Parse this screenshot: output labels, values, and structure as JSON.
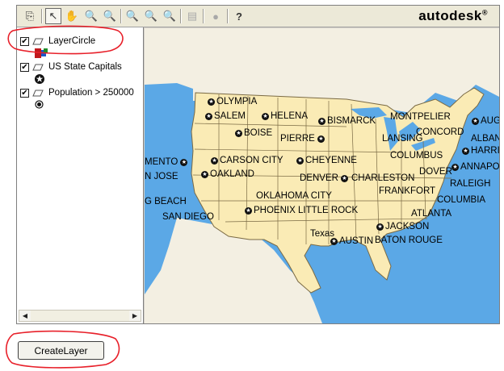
{
  "brand": {
    "name": "autodesk",
    "mark": "®"
  },
  "toolbar": {
    "buttons": [
      {
        "icon": "copy-icon",
        "glyph": "⎘"
      },
      {
        "icon": "select-arrow-icon",
        "glyph": "↖"
      },
      {
        "icon": "pan-hand-icon",
        "glyph": "✋"
      },
      {
        "icon": "zoom-in-icon",
        "glyph": "🔍"
      },
      {
        "icon": "zoom-out-icon",
        "glyph": "🔍"
      },
      {
        "icon": "zoom-previous-icon",
        "glyph": "🔍"
      },
      {
        "icon": "zoom-extents-icon",
        "glyph": "🔍"
      },
      {
        "icon": "zoom-clear-icon",
        "glyph": "🔍"
      },
      {
        "icon": "properties-icon",
        "glyph": "▤"
      },
      {
        "icon": "stop-icon",
        "glyph": "●"
      },
      {
        "icon": "help-icon",
        "glyph": "?"
      }
    ]
  },
  "layers": [
    {
      "name": "LayerCircle",
      "checked": "✔",
      "symbol": "square-symbol-icon"
    },
    {
      "name": "US State Capitals",
      "checked": "✔",
      "symbol": "star-symbol-icon"
    },
    {
      "name": "Population > 250000",
      "checked": "✔",
      "symbol": "dot-symbol-icon"
    }
  ],
  "scroll": {
    "left": "◀",
    "right": "▶"
  },
  "cities": [
    {
      "name": "OLYMPIA"
    },
    {
      "name": "SALEM"
    },
    {
      "name": "HELENA"
    },
    {
      "name": "BISMARCK"
    },
    {
      "name": "MONTPELIER"
    },
    {
      "name": "AUGUST"
    },
    {
      "name": "BOISE"
    },
    {
      "name": "PIERRE"
    },
    {
      "name": "LANSING"
    },
    {
      "name": "CONCORD"
    },
    {
      "name": "ALBANY"
    },
    {
      "name": "HARRISBURG"
    },
    {
      "name": "MENTO"
    },
    {
      "name": "CARSON CITY"
    },
    {
      "name": "CHEYENNE"
    },
    {
      "name": "COLUMBUS"
    },
    {
      "name": "ANNAPOLIS"
    },
    {
      "name": "N JOSE"
    },
    {
      "name": "OAKLAND"
    },
    {
      "name": "DENVER"
    },
    {
      "name": "CHARLESTON"
    },
    {
      "name": "DOVER"
    },
    {
      "name": "FRANKFORT"
    },
    {
      "name": "RALEIGH"
    },
    {
      "name": "OKLAHOMA CITY"
    },
    {
      "name": "COLUMBIA"
    },
    {
      "name": "G BEACH"
    },
    {
      "name": "PHOENIX"
    },
    {
      "name": "LITTLE ROCK"
    },
    {
      "name": "ATLANTA"
    },
    {
      "name": "SAN DIEGO"
    },
    {
      "name": "JACKSON"
    },
    {
      "name": "Texas"
    },
    {
      "name": "AUSTIN"
    },
    {
      "name": "BATON ROUGE"
    }
  ],
  "create_button": {
    "label": "CreateLayer"
  },
  "colors": {
    "ocean": "#5ba8e6",
    "land": "#faebb5",
    "annotation": "#e8202a"
  }
}
